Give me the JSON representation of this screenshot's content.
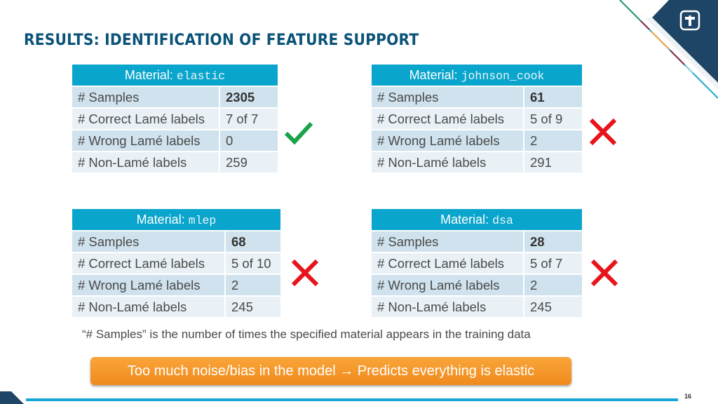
{
  "slide": {
    "title": "RESULTS: IDENTIFICATION OF FEATURE SUPPORT",
    "page_number": "16",
    "logo": "sandia-thunderbird-logo-icon"
  },
  "tables": [
    {
      "header_label": "Material:",
      "material": "elastic",
      "rows": [
        {
          "label": "# Samples",
          "value": "2305"
        },
        {
          "label": "# Correct Lamé labels",
          "value": "7 of 7"
        },
        {
          "label": "# Wrong Lamé labels",
          "value": "0"
        },
        {
          "label": "# Non-Lamé labels",
          "value": "259"
        }
      ],
      "result_icon": "checkmark-icon",
      "result_color": "#1aa34a"
    },
    {
      "header_label": "Material:",
      "material": "johnson_cook",
      "rows": [
        {
          "label": "# Samples",
          "value": "61"
        },
        {
          "label": "# Correct Lamé labels",
          "value": "5 of 9"
        },
        {
          "label": "# Wrong Lamé labels",
          "value": "2"
        },
        {
          "label": "# Non-Lamé labels",
          "value": "291"
        }
      ],
      "result_icon": "cross-icon",
      "result_color": "#e8141b"
    },
    {
      "header_label": "Material:",
      "material": "mlep",
      "rows": [
        {
          "label": "# Samples",
          "value": "68"
        },
        {
          "label": "# Correct Lamé labels",
          "value": "5 of 10"
        },
        {
          "label": "# Wrong Lamé labels",
          "value": "2"
        },
        {
          "label": "# Non-Lamé labels",
          "value": "245"
        }
      ],
      "result_icon": "cross-icon",
      "result_color": "#e8141b"
    },
    {
      "header_label": "Material:",
      "material": "dsa",
      "rows": [
        {
          "label": "# Samples",
          "value": "28"
        },
        {
          "label": "# Correct Lamé labels",
          "value": "5 of 7"
        },
        {
          "label": "# Wrong Lamé labels",
          "value": "2"
        },
        {
          "label": "# Non-Lamé labels",
          "value": "245"
        }
      ],
      "result_icon": "cross-icon",
      "result_color": "#e8141b"
    }
  ],
  "footnote": "“# Samples” is the number of times the specified material appears in the training data",
  "banner": {
    "text": "Too much noise/bias in the model → Predicts everything is elastic",
    "color": "#f39a29"
  }
}
